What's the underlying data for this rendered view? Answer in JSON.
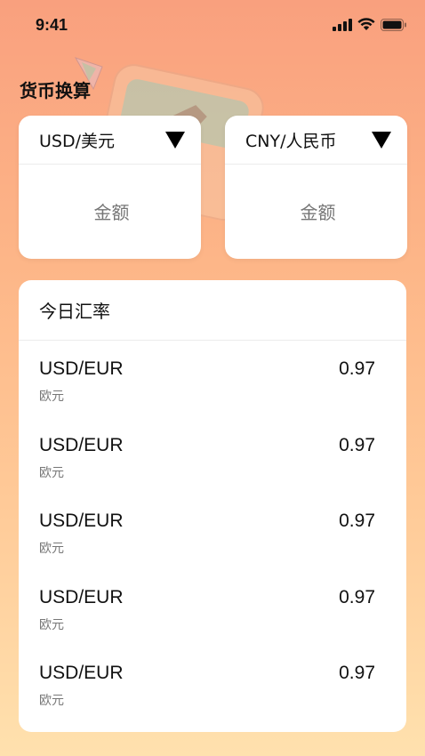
{
  "status": {
    "time": "9:41"
  },
  "header": {
    "title": "货币换算"
  },
  "converter": {
    "from": {
      "currency": "USD/美元",
      "amount_placeholder": "金额"
    },
    "to": {
      "currency": "CNY/人民币",
      "amount_placeholder": "金额"
    }
  },
  "rates": {
    "title": "今日汇率",
    "items": [
      {
        "pair": "USD/EUR",
        "name": "欧元",
        "value": "0.97"
      },
      {
        "pair": "USD/EUR",
        "name": "欧元",
        "value": "0.97"
      },
      {
        "pair": "USD/EUR",
        "name": "欧元",
        "value": "0.97"
      },
      {
        "pair": "USD/EUR",
        "name": "欧元",
        "value": "0.97"
      },
      {
        "pair": "USD/EUR",
        "name": "欧元",
        "value": "0.97"
      }
    ]
  },
  "colors": {
    "background_top": "#f9a07e",
    "background_bottom": "#ffe1ae",
    "card": "#ffffff",
    "secondary_text": "#777777"
  }
}
